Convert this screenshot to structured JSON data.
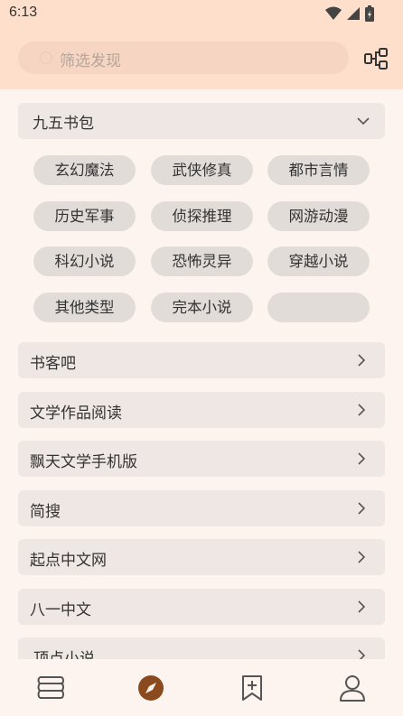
{
  "status_bar": {
    "time": "6:13"
  },
  "search": {
    "placeholder": "筛选发现"
  },
  "group": {
    "title": "九五书包",
    "tags": [
      "玄幻魔法",
      "武侠修真",
      "都市言情",
      "历史军事",
      "侦探推理",
      "网游动漫",
      "科幻小说",
      "恐怖灵异",
      "穿越小说",
      "其他类型",
      "完本小说",
      ""
    ]
  },
  "sources": [
    {
      "label": "书客吧"
    },
    {
      "label": "文学作品阅读"
    },
    {
      "label": "飘天文学手机版"
    },
    {
      "label": "简搜"
    },
    {
      "label": "起点中文网"
    },
    {
      "label": "八一中文"
    },
    {
      "label": "顶点小说"
    }
  ],
  "colors": {
    "header_bg": "#fddfcc",
    "page_bg": "#fdf4ef",
    "accent": "#8b4a1e"
  },
  "bottom_nav": {
    "items": [
      {
        "icon": "bookshelf-icon",
        "active": false
      },
      {
        "icon": "compass-icon",
        "active": true
      },
      {
        "icon": "bookmark-add-icon",
        "active": false
      },
      {
        "icon": "person-icon",
        "active": false
      }
    ]
  }
}
